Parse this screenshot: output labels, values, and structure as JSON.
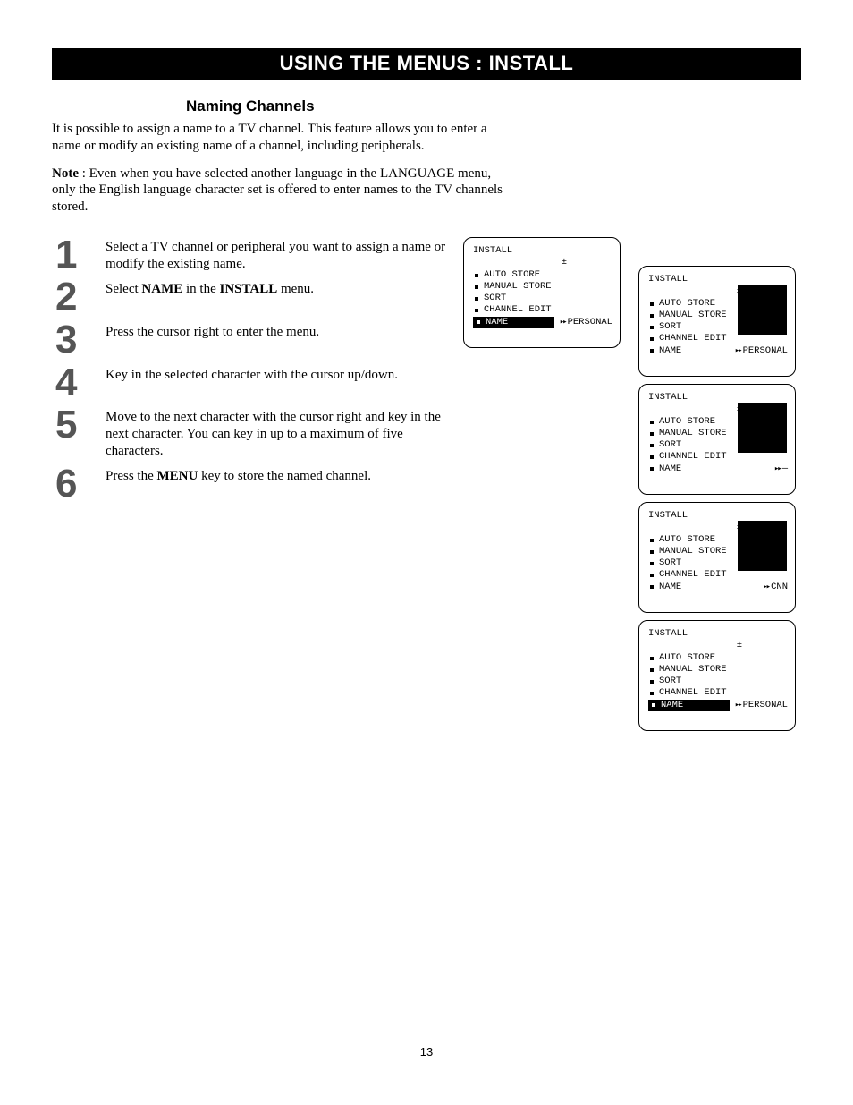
{
  "title_bar": "USING THE MENUS : INSTALL",
  "subhead": "Naming Channels",
  "intro": "It is possible to assign a name to a TV channel. This feature allows you to enter a name or modify an existing name of a channel, including peripherals.",
  "note_label": "Note",
  "note_body": " : Even when you have selected another language in the LANGUAGE menu, only the English language character set is offered to enter names to the TV channels stored.",
  "steps": [
    {
      "n": "1",
      "pre": "Select a TV channel or peripheral you want to assign a name or modify the existing name."
    },
    {
      "n": "2",
      "pre": "Select ",
      "b1": "NAME",
      "mid": " in the ",
      "b2": "INSTALL",
      "post": " menu."
    },
    {
      "n": "3",
      "pre": "Press the cursor right to enter the menu."
    },
    {
      "n": "4",
      "pre": "Key in the selected character with the cursor up/down."
    },
    {
      "n": "5",
      "pre": "Move to the next character with the cursor right and key in the next character. You can key in up to a maximum of five characters."
    },
    {
      "n": "6",
      "pre": "Press the ",
      "b1": "MENU",
      "post": " key to store the named channel."
    }
  ],
  "osd": {
    "header": "INSTALL",
    "pm": "±",
    "items": [
      "AUTO STORE",
      "MANUAL STORE",
      "SORT",
      "CHANNEL EDIT",
      "NAME"
    ],
    "arrow": "▸▸",
    "vals": {
      "personal": "PERSONAL",
      "dash": "—",
      "cnn": "CNN"
    }
  },
  "page_number": "13"
}
